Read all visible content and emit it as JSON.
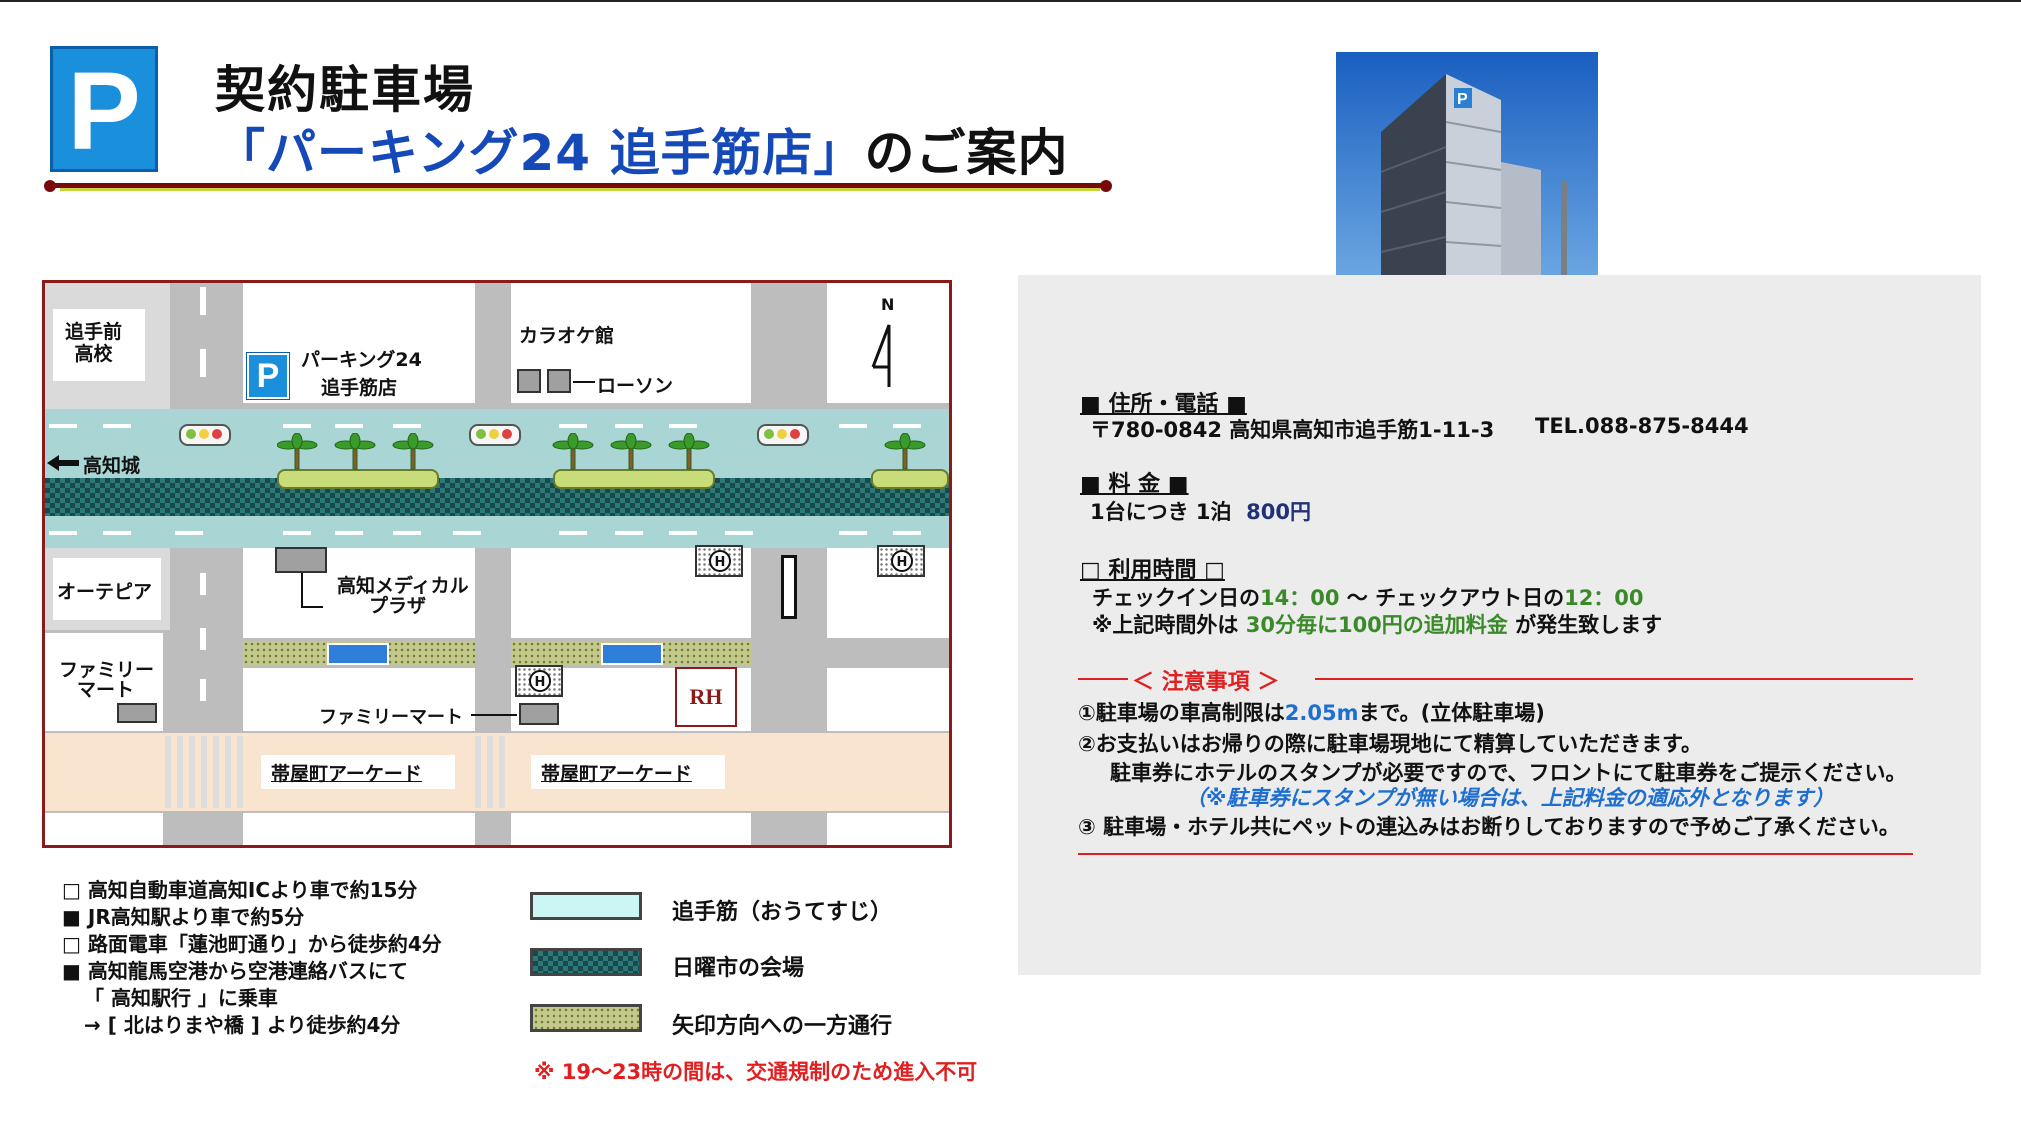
{
  "header": {
    "logo_letter": "P",
    "title_line1": "契約駐車場",
    "title_line2_blue": "「パーキング24 追手筋店」",
    "title_line2_rest": "のご案内"
  },
  "photo": {
    "sign": "P"
  },
  "map": {
    "north": "N",
    "labels": {
      "school": "追手前\n高校",
      "parking_name": "パーキング24",
      "parking_branch": "追手筋店",
      "parking_icon": "P",
      "karaoke": "カラオケ館",
      "lawson": "ローソン",
      "castle": "高知城",
      "oatepia": "オーテピア",
      "medical_1": "高知メディカル",
      "medical_2": "プラザ",
      "familymart_left_1": "ファミリー",
      "familymart_left_2": "マート",
      "familymart_center": "ファミリーマート",
      "arcade_left": "帯屋町アーケード",
      "arcade_right": "帯屋町アーケード",
      "hotel_mark": "H",
      "rh_logo": "RH"
    }
  },
  "access": [
    {
      "bullet": "□",
      "text": "高知自動車道高知ICより車で約15分"
    },
    {
      "bullet": "■",
      "text": "JR高知駅より車で約5分"
    },
    {
      "bullet": "□",
      "text": "路面電車「蓮池町通り」から徒歩約4分"
    },
    {
      "bullet": "■",
      "text": "高知龍馬空港から空港連絡バスにて"
    },
    {
      "bullet": "",
      "text": "「 高知駅行 」に乗車"
    },
    {
      "bullet": "",
      "text": "→ [ 北はりまや橋 ] より徒歩約4分"
    }
  ],
  "legend": {
    "items": [
      {
        "label": "追手筋（おうてすじ）",
        "color": "#ccf6f4"
      },
      {
        "label": "日曜市の会場",
        "color": "#174b4b"
      },
      {
        "label": "矢印方向への一方通行",
        "color": "#c2c98a"
      }
    ],
    "note": "※ 19～23時の間は、交通規制のため進入不可"
  },
  "info": {
    "address_heading": "■  住所・電話  ■",
    "address": "〒780-0842 高知県高知市追手筋1-11-3",
    "tel": "TEL.088-875-8444",
    "fee_heading": "■  料    金  ■",
    "fee_prefix": "1台につき 1泊",
    "fee_value": "800円",
    "hours_heading": "□  利用時間  □",
    "hours_a": "チェックイン日の",
    "hours_in": "14：00",
    "hours_b": " ～ チェックアウト日の",
    "hours_out": "12：00",
    "extra_a": "※上記時間外は ",
    "extra_fee": "30分毎に100円の追加料金",
    "extra_b": " が発生致します",
    "caution_heading": "＜  注意事項  ＞",
    "caution1_a": "①駐車場の車高制限は",
    "caution1_val": "2.05m",
    "caution1_b": "まで。(立体駐車場)",
    "caution2": "②お支払いはお帰りの際に駐車場現地にて精算していただきます。",
    "caution2_sub": "駐車券にホテルのスタンプが必要ですので、フロントにて駐車券をご提示ください。",
    "caution2_note": "（※駐車券にスタンプが無い場合は、上記料金の適応外となります）",
    "caution3": "③ 駐車場・ホテル共にペットの連込みはお断りしておりますので予めご了承ください。"
  }
}
